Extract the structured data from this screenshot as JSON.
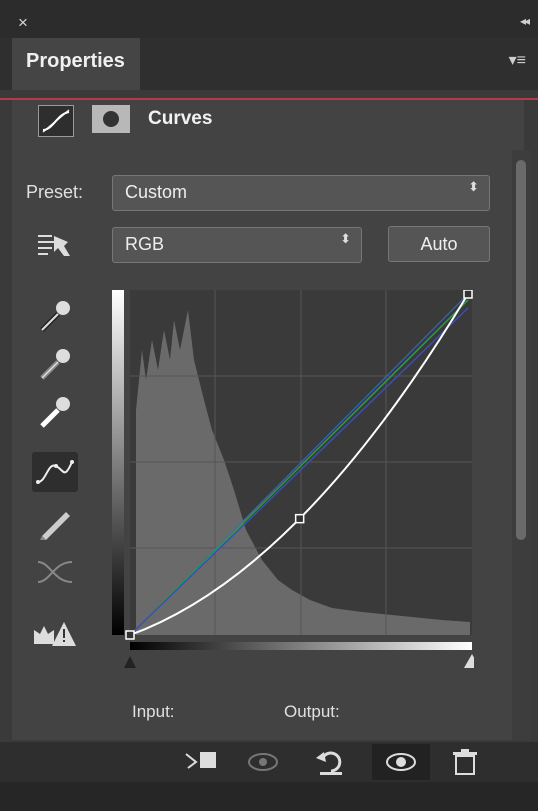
{
  "window": {
    "close_glyph": "×",
    "collapse_glyph": "◂◂",
    "menu_glyph": "▾≡"
  },
  "panel": {
    "tab_title": "Properties"
  },
  "adjustment": {
    "title": "Curves"
  },
  "preset": {
    "label": "Preset:",
    "value": "Custom",
    "arrows": "⬍"
  },
  "channel": {
    "value": "RGB",
    "arrows": "⬍"
  },
  "auto_button": {
    "label": "Auto"
  },
  "tools": [
    "sample-in-image-icon",
    "black-point-eyedropper-icon",
    "gray-point-eyedropper-icon",
    "white-point-eyedropper-icon",
    "edit-points-curve-icon",
    "draw-pencil-icon",
    "smooth-curve-icon",
    "clipping-warning-icon"
  ],
  "curve": {
    "points": [
      [
        0,
        0
      ],
      [
        128,
        87
      ],
      [
        255,
        255
      ]
    ],
    "colors": {
      "curve": "#ffffff",
      "green": "#2e9a4a",
      "blue": "#3b4fb0",
      "baseline": "#2a6fd0"
    }
  },
  "labels": {
    "input": "Input:",
    "output": "Output:"
  },
  "footer_icons": [
    "clip-to-layer-icon",
    "view-previous-state-icon",
    "reset-icon",
    "visibility-eye-icon",
    "delete-trash-icon"
  ]
}
